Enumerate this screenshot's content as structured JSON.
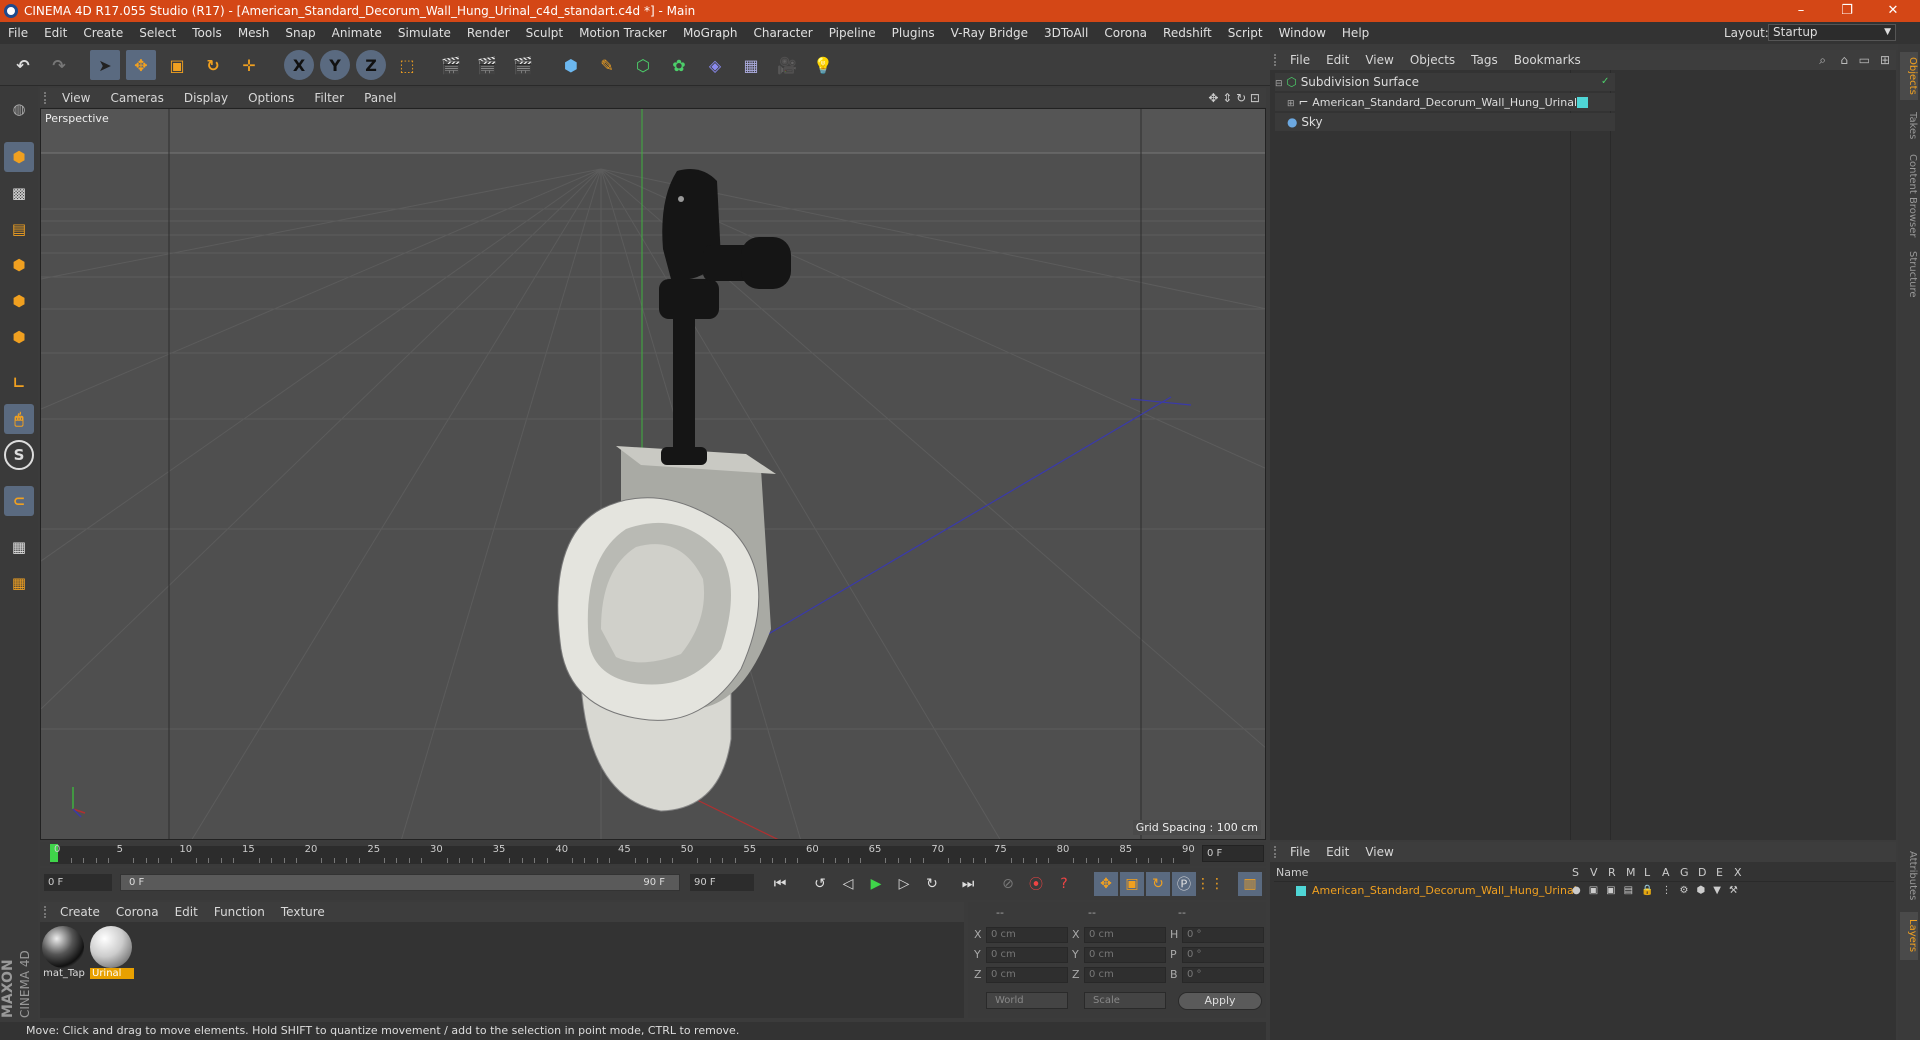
{
  "app": {
    "title": "CINEMA 4D R17.055 Studio (R17) - [American_Standard_Decorum_Wall_Hung_Urinal_c4d_standart.c4d *] - Main",
    "layout_label": "Layout:",
    "layout_value": "Startup"
  },
  "window_controls": {
    "minimize": "–",
    "restore": "❐",
    "close": "✕"
  },
  "menubar": [
    "File",
    "Edit",
    "Create",
    "Select",
    "Tools",
    "Mesh",
    "Snap",
    "Animate",
    "Simulate",
    "Render",
    "Sculpt",
    "Motion Tracker",
    "MoGraph",
    "Character",
    "Pipeline",
    "Plugins",
    "V-Ray Bridge",
    "3DToAll",
    "Corona",
    "Redshift",
    "Script",
    "Window",
    "Help"
  ],
  "toolbar": {
    "x": "X",
    "y": "Y",
    "z": "Z"
  },
  "left_tools": {
    "snap": "S"
  },
  "viewport": {
    "menu": [
      "View",
      "Cameras",
      "Display",
      "Options",
      "Filter",
      "Panel"
    ],
    "label": "Perspective",
    "grid_spacing": "Grid Spacing : 100 cm"
  },
  "timeline": {
    "ticks": [
      "0",
      "5",
      "10",
      "15",
      "20",
      "25",
      "30",
      "35",
      "40",
      "45",
      "50",
      "55",
      "60",
      "65",
      "70",
      "75",
      "80",
      "85",
      "90"
    ],
    "current_frame": "0 F"
  },
  "transport": {
    "start": "0 F",
    "range_start": "0 F",
    "range_end": "90 F",
    "end": "90 F"
  },
  "material_manager": {
    "menu": [
      "Create",
      "Corona",
      "Edit",
      "Function",
      "Texture"
    ],
    "materials": [
      {
        "name": "mat_Tap",
        "selected": false
      },
      {
        "name": "Urinal",
        "selected": true
      }
    ]
  },
  "coordinates": {
    "headers": [
      "--",
      "--",
      "--"
    ],
    "rows": [
      {
        "a": "X",
        "av": "0 cm",
        "b": "X",
        "bv": "0 cm",
        "c": "H",
        "cv": "0 °"
      },
      {
        "a": "Y",
        "av": "0 cm",
        "b": "Y",
        "bv": "0 cm",
        "c": "P",
        "cv": "0 °"
      },
      {
        "a": "Z",
        "av": "0 cm",
        "b": "Z",
        "bv": "0 cm",
        "c": "B",
        "cv": "0 °"
      }
    ],
    "mode1": "World",
    "mode2": "Scale",
    "apply": "Apply"
  },
  "status": "Move: Click and drag to move elements. Hold SHIFT to quantize movement / add to the selection in point mode, CTRL to remove.",
  "object_manager": {
    "menu": [
      "File",
      "Edit",
      "View",
      "Objects",
      "Tags",
      "Bookmarks"
    ],
    "objects": [
      {
        "name": "Subdivision Surface",
        "indent": 0
      },
      {
        "name": "American_Standard_Decorum_Wall_Hung_Urinal",
        "indent": 1
      },
      {
        "name": "Sky",
        "indent": 0
      }
    ]
  },
  "layer_manager": {
    "menu": [
      "File",
      "Edit",
      "View"
    ],
    "header_name": "Name",
    "header_cols": [
      "S",
      "V",
      "R",
      "M",
      "L",
      "A",
      "G",
      "D",
      "E",
      "X"
    ],
    "layer_name": "American_Standard_Decorum_Wall_Hung_Urinal"
  },
  "right_tabs": [
    "Objects",
    "Takes",
    "Content Browser",
    "Structure",
    "Attributes",
    "Layers"
  ],
  "branding": {
    "maxon": "MAXON",
    "cinema": "CINEMA 4D"
  },
  "colors": {
    "titlebar": "#d44716",
    "accent": "#e8a000",
    "selection": "#f0a020",
    "axis_y": "#3fb03f",
    "axis_z": "#3a3aaa",
    "axis_x": "#b03030"
  }
}
